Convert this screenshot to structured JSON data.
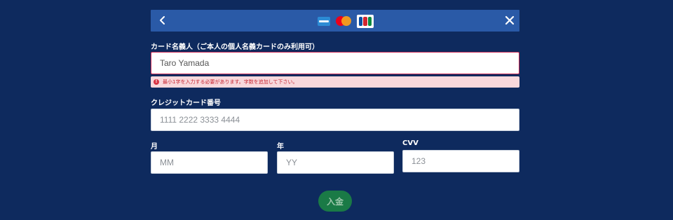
{
  "header": {
    "back_icon": "chevron-left-icon",
    "close_icon": "close-icon",
    "card_brands": [
      "amex-icon",
      "mastercard-icon",
      "jcb-icon"
    ]
  },
  "form": {
    "cardholder": {
      "label": "カード名義人（ご本人の個人名義カードのみ利用可）",
      "value": "Taro Yamada",
      "error": "最小1字を入力する必要があります。字数を追加して下さい。"
    },
    "card_number": {
      "label": "クレジットカード番号",
      "placeholder": "1111 2222 3333 4444"
    },
    "month": {
      "label": "月",
      "placeholder": "MM"
    },
    "year": {
      "label": "年",
      "placeholder": "YY"
    },
    "cvv": {
      "label": "CVV",
      "placeholder": "123"
    },
    "submit_label": "入金"
  },
  "colors": {
    "background": "#0e2a5e",
    "header": "#2a5aa7",
    "error": "#c62632",
    "submit": "#1a7a46"
  }
}
